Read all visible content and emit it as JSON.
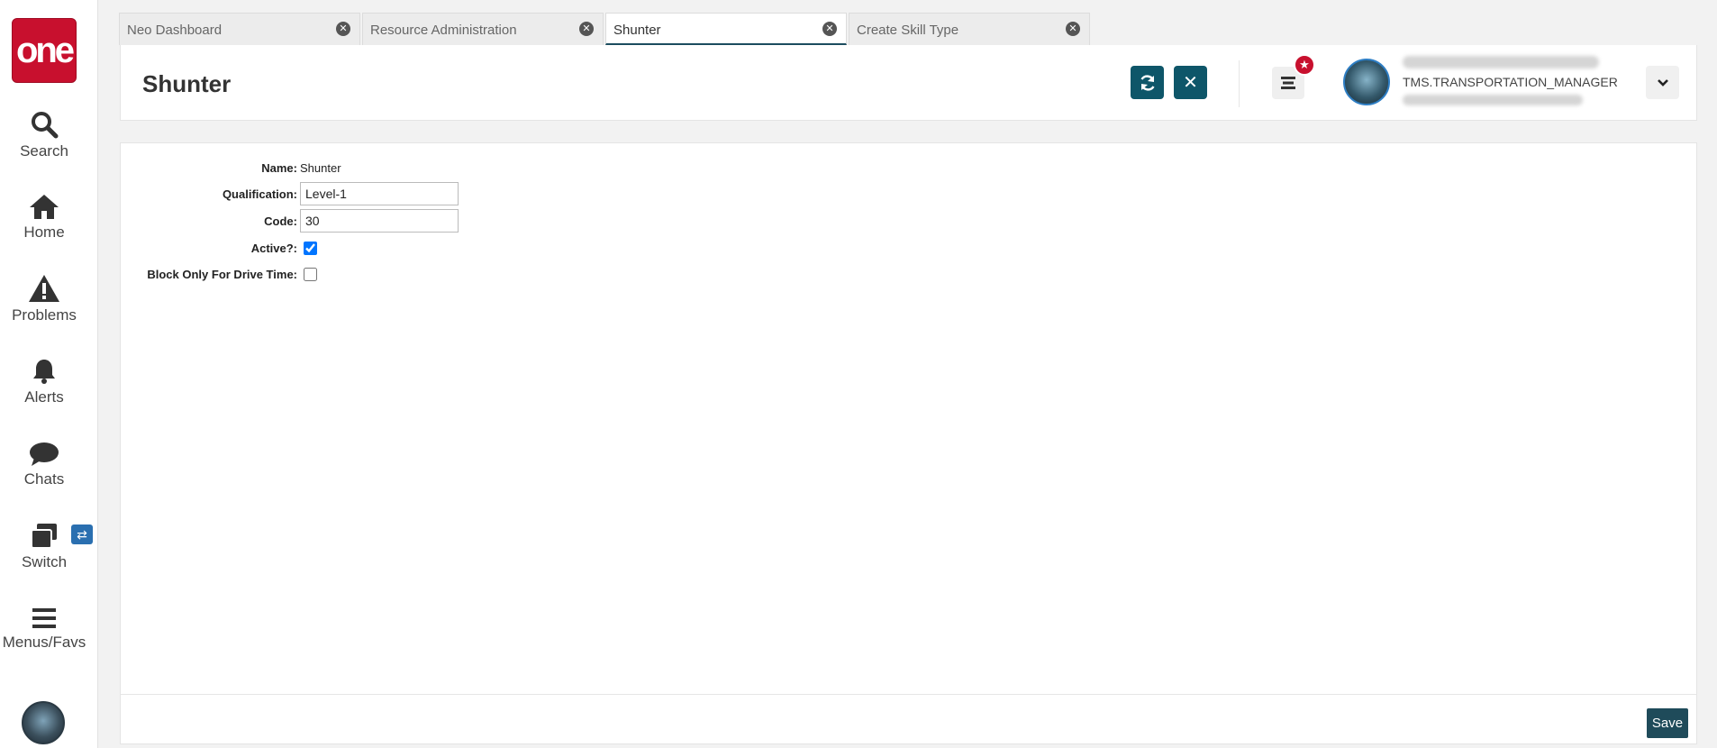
{
  "sidebar": {
    "logo_text": "one",
    "items": [
      {
        "label": "Search",
        "icon": "search-icon"
      },
      {
        "label": "Home",
        "icon": "home-icon"
      },
      {
        "label": "Problems",
        "icon": "warning-icon"
      },
      {
        "label": "Alerts",
        "icon": "bell-icon"
      },
      {
        "label": "Chats",
        "icon": "chat-icon"
      },
      {
        "label": "Switch",
        "icon": "windows-icon"
      },
      {
        "label": "Menus/Favs",
        "icon": "hamburger-icon"
      }
    ],
    "switch_badge_icon": "swap-arrows-icon"
  },
  "tabs": [
    {
      "label": "Neo Dashboard",
      "active": false
    },
    {
      "label": "Resource Administration",
      "active": false
    },
    {
      "label": "Shunter",
      "active": true
    },
    {
      "label": "Create Skill Type",
      "active": false
    }
  ],
  "header": {
    "title": "Shunter",
    "refresh_icon": "refresh-icon",
    "close_icon": "close-icon",
    "menu_icon": "list-icon",
    "fav_badge_icon": "star-icon",
    "user_role": "TMS.TRANSPORTATION_MANAGER",
    "dropdown_icon": "chevron-down-icon"
  },
  "form": {
    "name_label": "Name:",
    "name_value": "Shunter",
    "qualification_label": "Qualification:",
    "qualification_value": "Level-1",
    "code_label": "Code:",
    "code_value": "30",
    "active_label": "Active?:",
    "active_checked": true,
    "block_label": "Block Only For Drive Time:",
    "block_checked": false
  },
  "footer": {
    "save_label": "Save"
  },
  "colors": {
    "brand_red": "#c8102e",
    "accent_teal": "#0e5669",
    "save_button": "#1f4b5a"
  }
}
